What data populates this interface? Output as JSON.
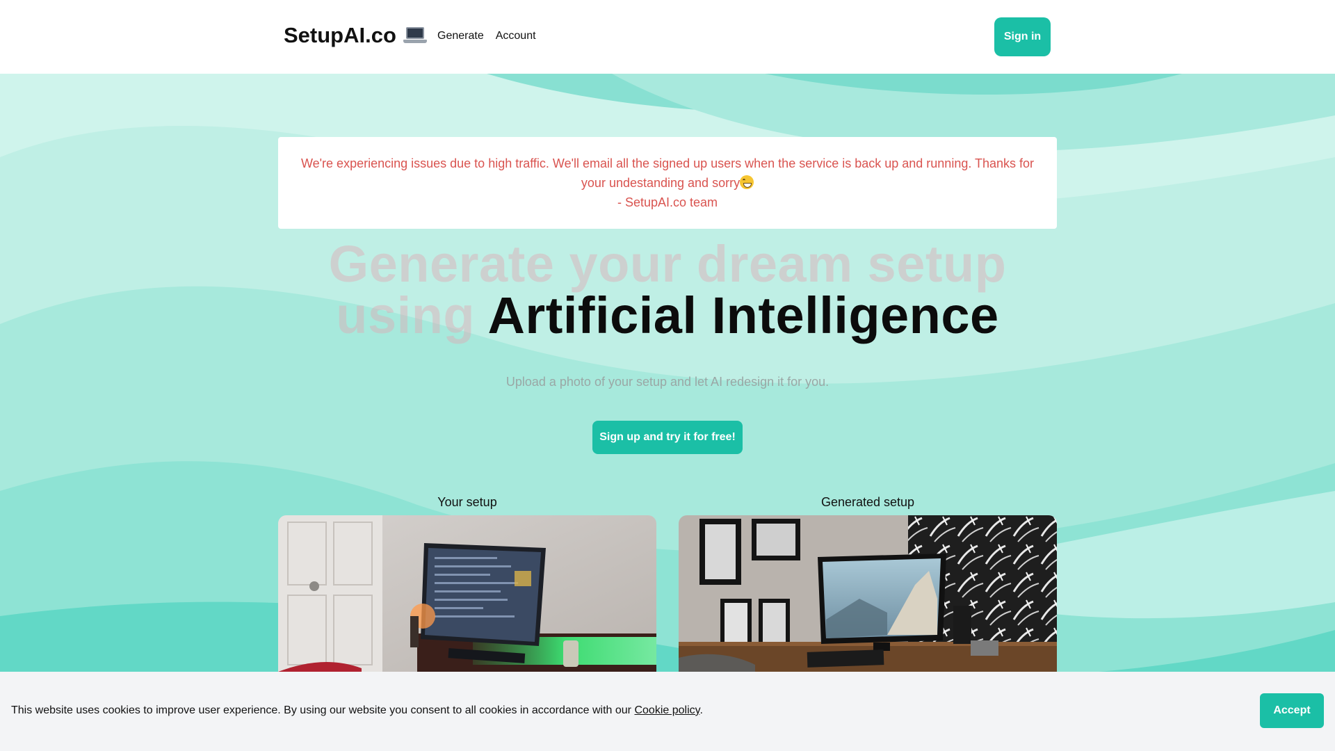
{
  "header": {
    "logo_text": "SetupAI.co",
    "logo_icon": "laptop-icon",
    "nav": [
      {
        "label": "Generate"
      },
      {
        "label": "Account"
      }
    ],
    "signin_label": "Sign in"
  },
  "alert": {
    "line1": "We're experiencing issues due to high traffic. We'll email all the signed up users when the service is back up and running. Thanks for",
    "line2": "your undestanding and sorry",
    "line2_emoji": "grinning-face-icon",
    "signature": "- SetupAI.co team"
  },
  "hero": {
    "headline_faded_1": "Generate your dream setup",
    "headline_faded_2": "using",
    "headline_strong": "Artificial Intelligence",
    "subtitle": "Upload a photo of your setup and let AI redesign it for you.",
    "cta_label": "Sign up and try it for free!"
  },
  "comparison": {
    "left_title": "Your setup",
    "right_title": "Generated setup"
  },
  "cookie_banner": {
    "text": "This website uses cookies to improve user experience. By using our website you consent to all cookies in accordance with our",
    "link_label": "Cookie policy",
    "trailing": ".",
    "accept_label": "Accept"
  },
  "colors": {
    "accent": "#1bbfa6",
    "alert_text": "#d9534f",
    "hero_light": "#cdf4ec",
    "hero_mid": "#a5e8db",
    "hero_dark": "#5fd8c6"
  }
}
